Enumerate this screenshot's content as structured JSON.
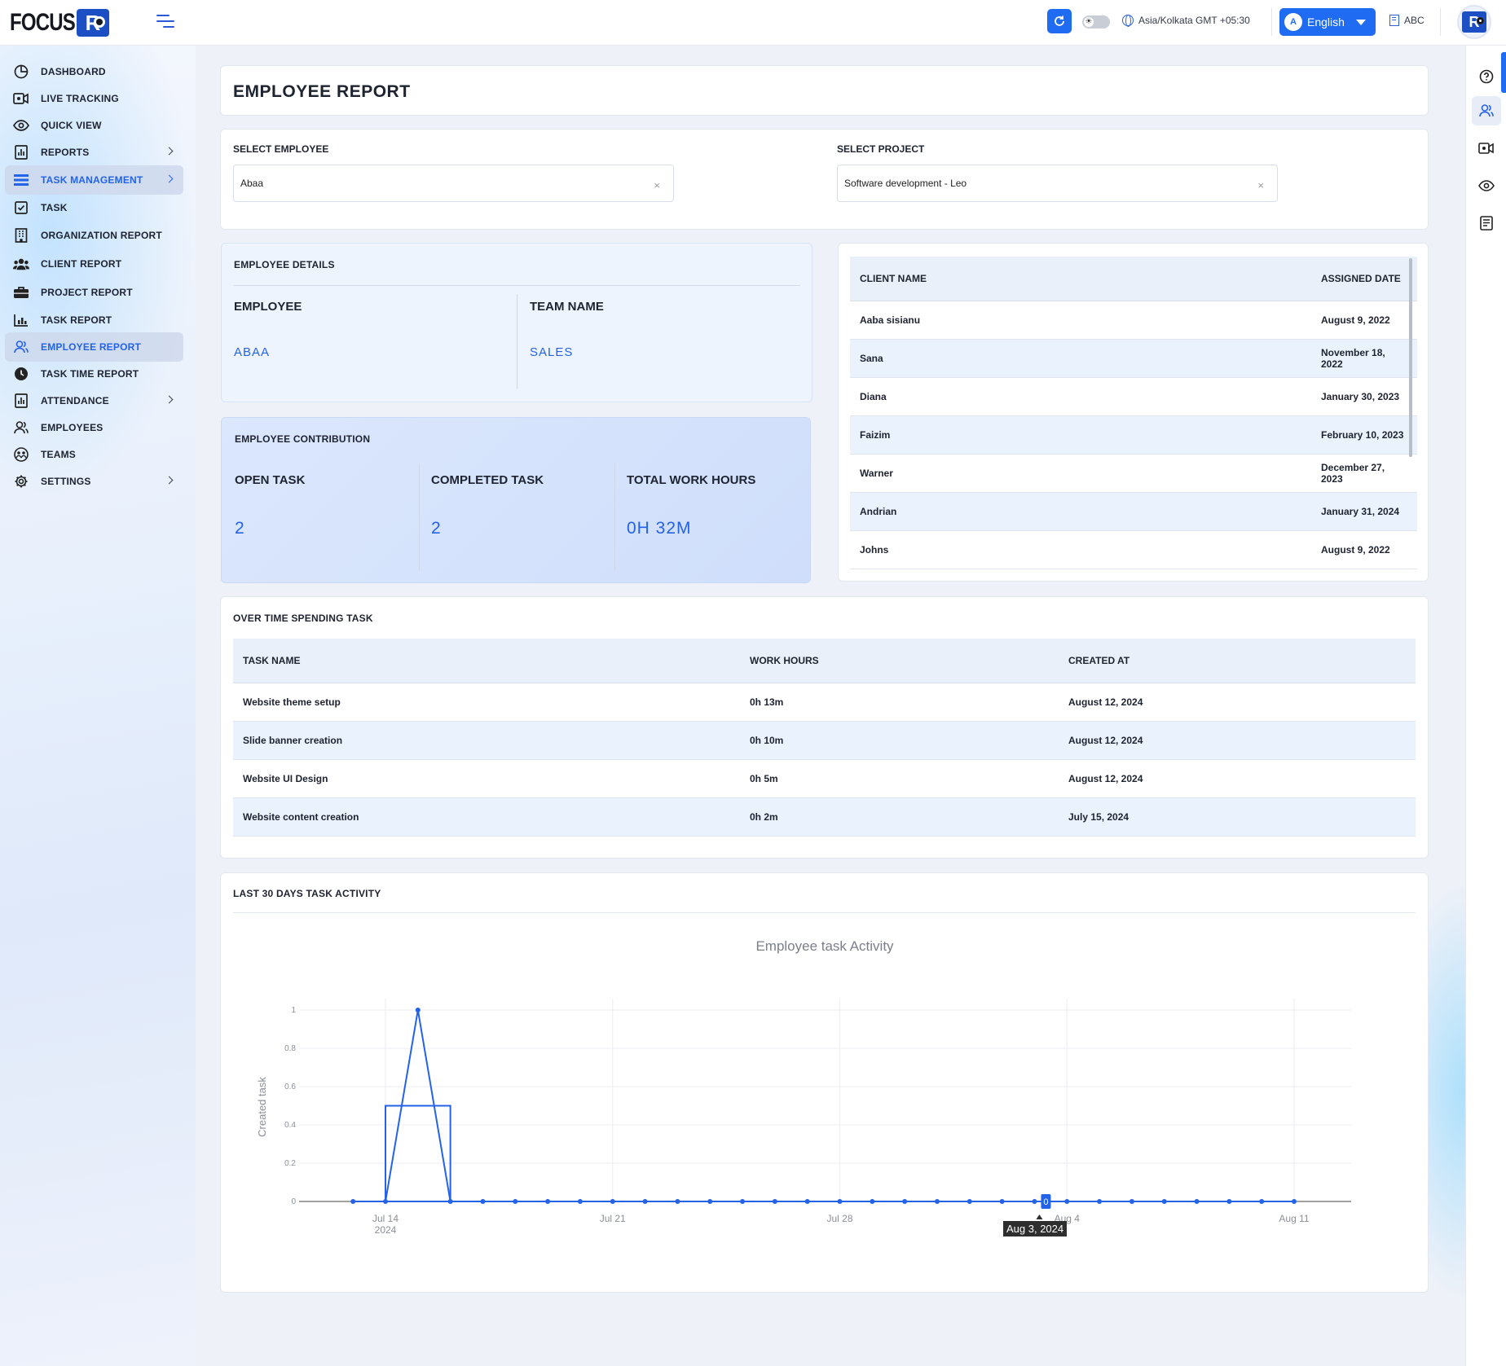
{
  "header": {
    "logo_text": "FOCUS",
    "logo_badge": "R",
    "timezone": "Asia/Kolkata GMT +05:30",
    "language": "English",
    "language_icon_text": "A",
    "org_name": "ABC",
    "theme_icon": "sun-icon",
    "avatar_text": "R"
  },
  "sidebar": {
    "items": [
      {
        "label": "DASHBOARD",
        "icon": "pie-chart-icon"
      },
      {
        "label": "LIVE TRACKING",
        "icon": "video-icon"
      },
      {
        "label": "QUICK VIEW",
        "icon": "eye-icon"
      },
      {
        "label": "REPORTS",
        "icon": "bar-chart-icon",
        "has_submenu": true
      },
      {
        "label": "TASK MANAGEMENT",
        "icon": "list-icon",
        "has_submenu": true,
        "active": true
      },
      {
        "label": "TASK",
        "icon": "checkbox-icon"
      },
      {
        "label": "ORGANIZATION REPORT",
        "icon": "building-icon"
      },
      {
        "label": "CLIENT REPORT",
        "icon": "users-group-icon"
      },
      {
        "label": "PROJECT REPORT",
        "icon": "briefcase-icon"
      },
      {
        "label": "TASK REPORT",
        "icon": "task-chart-icon"
      },
      {
        "label": "EMPLOYEE REPORT",
        "icon": "user-icon",
        "active": true
      },
      {
        "label": "TASK TIME REPORT",
        "icon": "clock-icon"
      },
      {
        "label": "ATTENDANCE",
        "icon": "attendance-chart-icon",
        "has_submenu": true
      },
      {
        "label": "EMPLOYEES",
        "icon": "users-icon"
      },
      {
        "label": "TEAMS",
        "icon": "teams-icon"
      },
      {
        "label": "SETTINGS",
        "icon": "gear-icon",
        "has_submenu": true
      }
    ]
  },
  "page": {
    "title": "EMPLOYEE REPORT"
  },
  "filters": {
    "employee_label": "SELECT EMPLOYEE",
    "employee_value": "Abaa",
    "project_label": "SELECT PROJECT",
    "project_value": "Software development - Leo",
    "clear_symbol": "×"
  },
  "employee_details": {
    "title": "EMPLOYEE DETAILS",
    "employee_head": "EMPLOYEE",
    "employee_value": "ABAA",
    "team_head": "TEAM NAME",
    "team_value": "SALES"
  },
  "contribution": {
    "title": "EMPLOYEE CONTRIBUTION",
    "open_head": "OPEN TASK",
    "open_value": "2",
    "completed_head": "COMPLETED TASK",
    "completed_value": "2",
    "hours_head": "TOTAL WORK HOURS",
    "hours_value": "0H 32M"
  },
  "clients": {
    "headers": [
      "CLIENT NAME",
      "ASSIGNED DATE"
    ],
    "rows": [
      [
        "Aaba sisianu",
        "August 9, 2022"
      ],
      [
        "Sana",
        "November 18, 2022"
      ],
      [
        "Diana",
        "January 30, 2023"
      ],
      [
        "Faizim",
        "February 10, 2023"
      ],
      [
        "Warner",
        "December 27, 2023"
      ],
      [
        "Andrian",
        "January 31, 2024"
      ],
      [
        "Johns",
        "August 9, 2022"
      ]
    ]
  },
  "overtime": {
    "title": "OVER TIME SPENDING TASK",
    "headers": [
      "TASK NAME",
      "WORK HOURS",
      "CREATED AT"
    ],
    "rows": [
      [
        "Website theme setup",
        "0h 13m",
        "August 12, 2024"
      ],
      [
        "Slide banner creation",
        "0h 10m",
        "August 12, 2024"
      ],
      [
        "Website UI Design",
        "0h 5m",
        "August 12, 2024"
      ],
      [
        "Website content creation",
        "0h 2m",
        "July 15, 2024"
      ]
    ]
  },
  "activity": {
    "title": "LAST 30 DAYS TASK ACTIVITY"
  },
  "chart_data": {
    "type": "line",
    "title": "Employee task Activity",
    "xlabel": "",
    "ylabel": "Created task",
    "x_tick_labels": [
      "Jul 14\n2024",
      "Jul 21",
      "Jul 28",
      "Aug 4",
      "Aug 11"
    ],
    "x_tick_dates": [
      "2024-07-14",
      "2024-07-21",
      "2024-07-28",
      "2024-08-04",
      "2024-08-11"
    ],
    "y_ticks": [
      0,
      0.2,
      0.4,
      0.6,
      0.8,
      1
    ],
    "ylim": [
      0,
      1
    ],
    "grid": true,
    "x": [
      "2024-07-13",
      "2024-07-14",
      "2024-07-15",
      "2024-07-16",
      "2024-07-17",
      "2024-07-18",
      "2024-07-19",
      "2024-07-20",
      "2024-07-21",
      "2024-07-22",
      "2024-07-23",
      "2024-07-24",
      "2024-07-25",
      "2024-07-26",
      "2024-07-27",
      "2024-07-28",
      "2024-07-29",
      "2024-07-30",
      "2024-07-31",
      "2024-08-01",
      "2024-08-02",
      "2024-08-03",
      "2024-08-04",
      "2024-08-05",
      "2024-08-06",
      "2024-08-07",
      "2024-08-08",
      "2024-08-09",
      "2024-08-10",
      "2024-08-11"
    ],
    "series": [
      {
        "values": [
          0,
          0,
          1,
          0,
          0,
          0,
          0,
          0,
          0,
          0,
          0,
          0,
          0,
          0,
          0,
          0,
          0,
          0,
          0,
          0,
          0,
          0,
          0,
          0,
          0,
          0,
          0,
          0,
          0,
          0
        ]
      }
    ],
    "box": {
      "x_start": "2024-07-14",
      "x_end": "2024-07-16",
      "value": 0.5
    },
    "hover": {
      "date_label": "Aug 3, 2024",
      "value_label": "0"
    },
    "color": "#2463e8"
  }
}
